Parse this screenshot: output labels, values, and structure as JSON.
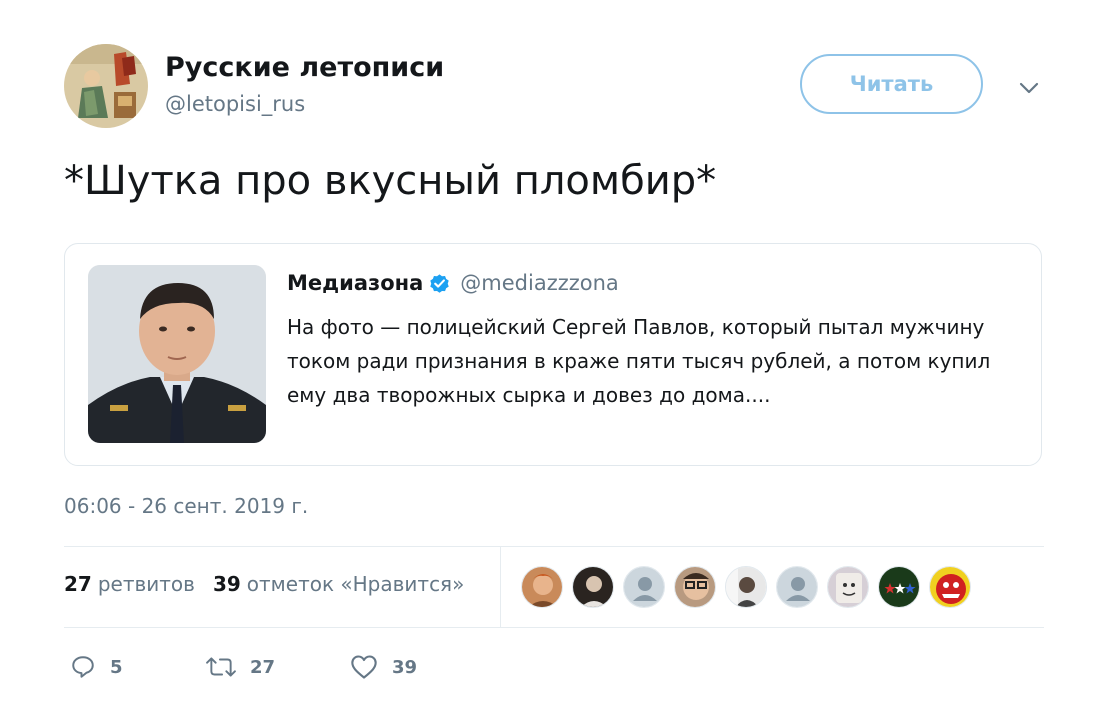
{
  "author": {
    "name": "Русские летописи",
    "handle": "@letopisi_rus",
    "avatar_icon": "manuscript-miniature-avatar"
  },
  "follow_button_label": "Читать",
  "menu_icon": "chevron-down-icon",
  "tweet": {
    "text": "*Шутка про вкусный пломбир*"
  },
  "quote": {
    "name": "Медиазона",
    "handle": "@mediazzzona",
    "verified_icon": "verified-badge-icon",
    "photo_icon": "police-officer-photo",
    "text": "На фото — полицейский Сергей Павлов, который пытал мужчину током ради признания в краже пяти тысяч рублей, а потом купил ему два творожных сырка и довез до дома...."
  },
  "timestamp": "06:06 - 26 сент. 2019 г.",
  "stats": {
    "retweets_count": "27",
    "retweets_label": "ретвитов",
    "likes_count": "39",
    "likes_label": "отметок «Нравится»"
  },
  "likers": [
    "photo",
    "photo",
    "default",
    "photo",
    "photo",
    "default",
    "photo",
    "flag",
    "cartoon"
  ],
  "actions": {
    "reply_count": "5",
    "retweet_count": "27",
    "like_count": "39"
  },
  "colors": {
    "accent": "#1da1f2",
    "follow_border": "#8ec3e8",
    "muted": "#657786",
    "text": "#14171a",
    "border": "#e1e8ed"
  }
}
